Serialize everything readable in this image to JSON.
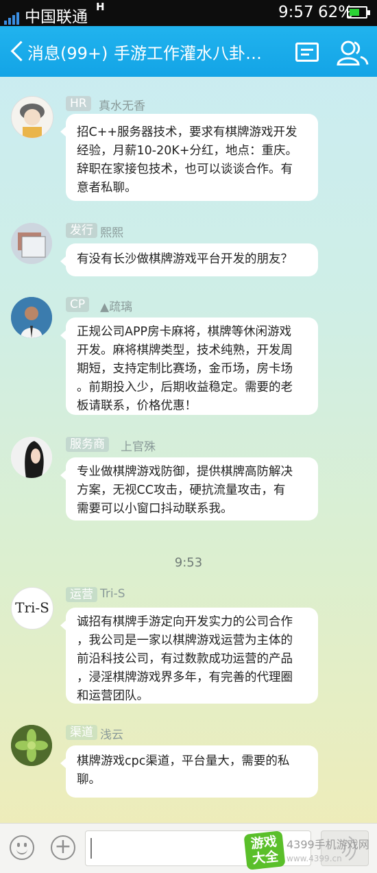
{
  "status_bar": {
    "carrier": "中国联通",
    "network": "H",
    "time": "9:57",
    "battery_pct": "62%",
    "battery_level": 0.62
  },
  "header": {
    "back_label": "消息(99+)",
    "group_title": "手游工作灌水八卦…",
    "icons": [
      "back-chevron-icon",
      "notice-icon",
      "members-icon"
    ]
  },
  "messages": [
    {
      "tag": "HR",
      "tag_color": "#c5d5d6",
      "sender": "真水无香",
      "lines": [
        "招C++服务器技术，要求有棋牌游戏开发",
        "经验，月薪10-20K+分红，地点：重庆。",
        "辞职在家接包技术，也可以谈谈合作。有",
        "意者私聊。"
      ]
    },
    {
      "tag": "发行",
      "tag_color": "#c1d4d1",
      "sender": "熙熙",
      "lines": [
        "有没有长沙做棋牌游戏平台开发的朋友？"
      ]
    },
    {
      "tag": "CP",
      "tag_color": "#c1d6d1",
      "sender": "▲疏璃",
      "lines": [
        "正规公司APP房卡麻将，棋牌等休闲游戏",
        "开发。麻将棋牌类型，技术纯熟，开发周",
        "期短，支持定制比赛场，金币场，房卡场",
        "。前期投入少，后期收益稳定。需要的老",
        "板请联系，价格优惠！"
      ]
    },
    {
      "tag": "服务商",
      "tag_color": "#c3d8cf",
      "sender": "上官殊",
      "lines": [
        "专业做棋牌游戏防御，提供棋牌高防解决",
        "方案，无视CC攻击，硬抗流量攻击，有",
        "需要可以小窗口抖动联系我。"
      ]
    },
    {
      "tag": "运营",
      "tag_color": "#c6ddc8",
      "sender": "Tri-S",
      "avatar_text": "Tri-S",
      "lines": [
        "诚招有棋牌手游定向开发实力的公司合作",
        "，我公司是一家以棋牌游戏运营为主体的",
        "前沿科技公司，有过数款成功运营的产品",
        "，浸淫棋牌游戏界多年，有完善的代理圈",
        "和运营团队。"
      ]
    },
    {
      "tag": "渠道",
      "tag_color": "#cfe2bf",
      "sender": "浅云",
      "lines": [
        "棋牌游戏cpc渠道，平台量大，需要的私",
        "聊。"
      ]
    }
  ],
  "timestamp": "9:53",
  "input_bar": {
    "icons": [
      "emoji-icon",
      "plus-icon",
      "voice-icon"
    ]
  },
  "watermark": {
    "logo_line1": "游戏",
    "logo_line2": "大全",
    "site": "4399手机游戏网",
    "url": "www.4399.cn"
  }
}
